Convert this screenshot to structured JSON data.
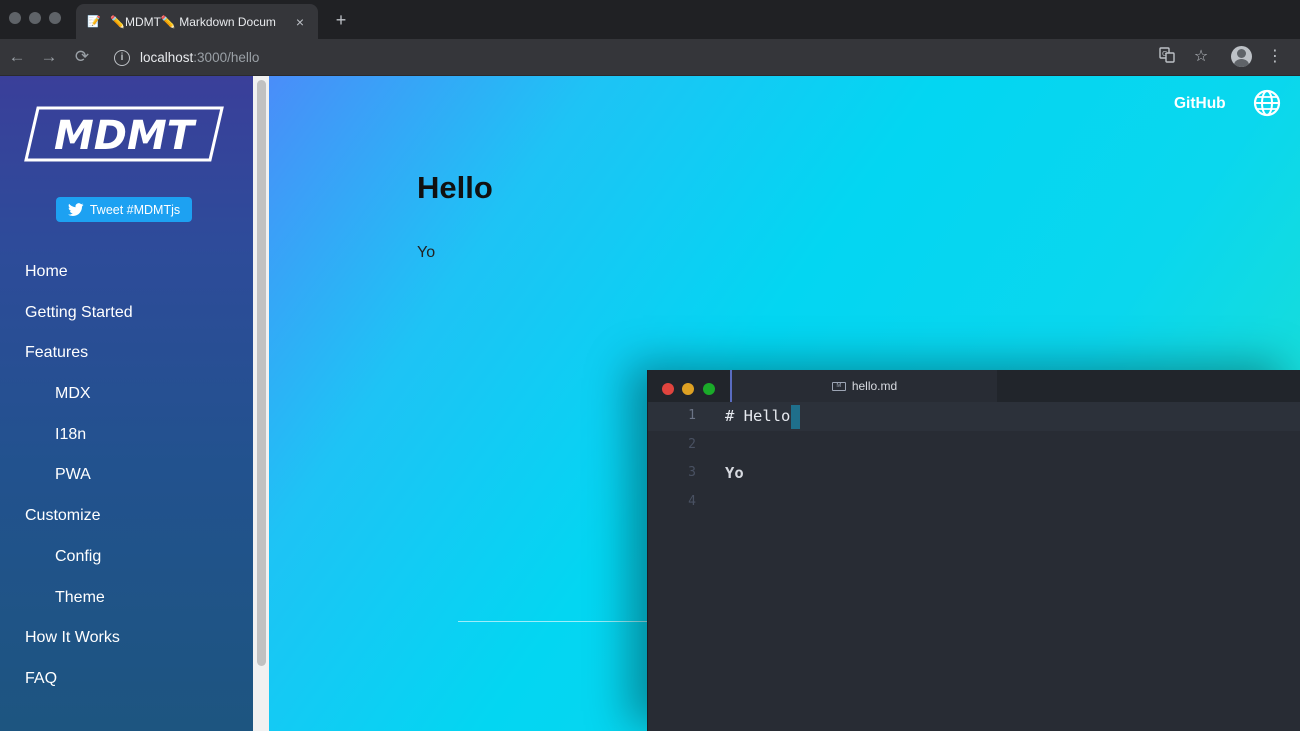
{
  "browser": {
    "tab_favicon": "📝",
    "tab_title": "✏️MDMT✏️ Markdown Docum",
    "tab_close": "×",
    "new_tab": "+",
    "nav": {
      "back": "←",
      "forward": "→",
      "reload": "⟳"
    },
    "url_host": "localhost",
    "url_path": ":3000/hello",
    "icons": {
      "translate": "translate-icon",
      "star": "☆",
      "menu": "⋮"
    }
  },
  "sidebar": {
    "logo_text": "MDMT",
    "tweet_label": "Tweet #MDMTjs",
    "items": [
      {
        "label": "Home",
        "sub": false
      },
      {
        "label": "Getting Started",
        "sub": false
      },
      {
        "label": "Features",
        "sub": false
      },
      {
        "label": "MDX",
        "sub": true
      },
      {
        "label": "I18n",
        "sub": true
      },
      {
        "label": "PWA",
        "sub": true
      },
      {
        "label": "Customize",
        "sub": false
      },
      {
        "label": "Config",
        "sub": true
      },
      {
        "label": "Theme",
        "sub": true
      },
      {
        "label": "How It Works",
        "sub": false
      },
      {
        "label": "FAQ",
        "sub": false
      }
    ]
  },
  "header": {
    "github_label": "GitHub"
  },
  "content": {
    "title": "Hello",
    "body": "Yo"
  },
  "editor": {
    "filename": "hello.md",
    "lines": [
      {
        "num": "1",
        "text": "# Hello"
      },
      {
        "num": "2",
        "text": ""
      },
      {
        "num": "3",
        "text": "Yo"
      },
      {
        "num": "4",
        "text": ""
      }
    ]
  },
  "colors": {
    "tweet_blue": "#1da1f2",
    "editor_bg": "#282c34",
    "traffic_red": "#e0443e",
    "traffic_yellow": "#dea123",
    "traffic_green": "#1aab29"
  }
}
